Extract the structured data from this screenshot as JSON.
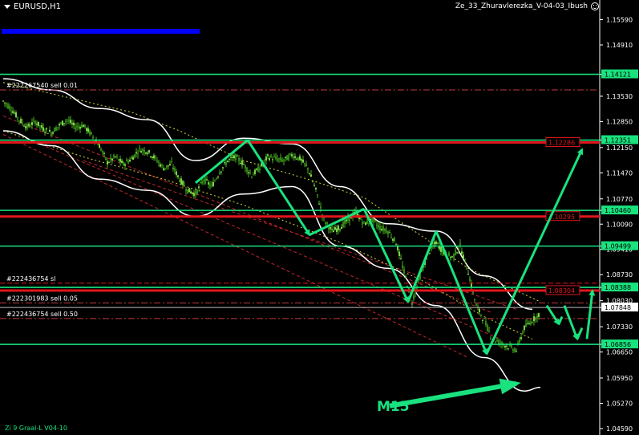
{
  "header": {
    "symbol_timeframe": "EURUSD,H1",
    "indicator_name": "Ze_33_Zhuravlerezka_V-04-03_Ibush"
  },
  "footer": {
    "text": "Zi 9 Graal-L V04-10"
  },
  "annotation": {
    "label": "M15"
  },
  "colors": {
    "background": "#000000",
    "green_level": "#19e27e",
    "red_level": "#e0161b",
    "arrow": "#19e27e",
    "band_white": "#ffffff",
    "blue_bar": "#0000ff",
    "candle": "#4caf20"
  },
  "chart_data": {
    "type": "candlestick",
    "symbol": "EURUSD",
    "timeframe": "H1",
    "y_axis": {
      "ticks": [
        "1.15590",
        "1.14910",
        "1.14121",
        "1.13530",
        "1.12850",
        "1.12351",
        "1.12150",
        "1.11470",
        "1.10770",
        "1.10460",
        "1.10090",
        "1.09499",
        "1.09410",
        "1.08730",
        "1.08388",
        "1.08030",
        "1.07848",
        "1.07330",
        "1.06856",
        "1.06650",
        "1.05950",
        "1.05270",
        "1.04590"
      ],
      "range": [
        1.0459,
        1.1586
      ]
    },
    "green_levels": [
      {
        "price": 1.14121,
        "label": "1.14121"
      },
      {
        "price": 1.12351,
        "label": "1.12351"
      },
      {
        "price": 1.1046,
        "label": "1.10460"
      },
      {
        "price": 1.09499,
        "label": "1.09499"
      },
      {
        "price": 1.08388,
        "label": "1.08388"
      },
      {
        "price": 1.06856,
        "label": "1.06856"
      }
    ],
    "red_levels": [
      {
        "price": 1.12286,
        "label": "1.12286"
      },
      {
        "price": 1.10295,
        "label": "1.10295"
      },
      {
        "price": 1.08304,
        "label": "1.08304"
      }
    ],
    "current_price": {
      "price": 1.07848,
      "label": "1.07848"
    },
    "orders": [
      {
        "text": "#222267540 sell 0.01",
        "price": 1.137
      },
      {
        "text": "#222436754 sl",
        "price": 1.085
      },
      {
        "text": "#222301983 sell 0.05",
        "price": 1.0797
      },
      {
        "text": "#222436754 sell 0.50",
        "price": 1.0755
      }
    ],
    "price_path": [
      [
        0,
        1.134
      ],
      [
        10,
        1.132
      ],
      [
        20,
        1.129
      ],
      [
        30,
        1.127
      ],
      [
        40,
        1.1285
      ],
      [
        50,
        1.1265
      ],
      [
        60,
        1.1255
      ],
      [
        70,
        1.1275
      ],
      [
        80,
        1.129
      ],
      [
        90,
        1.127
      ],
      [
        100,
        1.1275
      ],
      [
        110,
        1.125
      ],
      [
        120,
        1.122
      ],
      [
        130,
        1.1175
      ],
      [
        140,
        1.119
      ],
      [
        150,
        1.117
      ],
      [
        160,
        1.1185
      ],
      [
        170,
        1.121
      ],
      [
        180,
        1.1205
      ],
      [
        190,
        1.1185
      ],
      [
        200,
        1.116
      ],
      [
        210,
        1.117
      ],
      [
        220,
        1.113
      ],
      [
        230,
        1.11
      ],
      [
        240,
        1.109
      ],
      [
        250,
        1.113
      ],
      [
        260,
        1.111
      ],
      [
        270,
        1.115
      ],
      [
        280,
        1.118
      ],
      [
        290,
        1.119
      ],
      [
        300,
        1.117
      ],
      [
        310,
        1.114
      ],
      [
        320,
        1.116
      ],
      [
        330,
        1.119
      ],
      [
        340,
        1.1185
      ],
      [
        350,
        1.118
      ],
      [
        360,
        1.1195
      ],
      [
        370,
        1.1185
      ],
      [
        380,
        1.116
      ],
      [
        390,
        1.11
      ],
      [
        400,
        1.102
      ],
      [
        410,
        1.099
      ],
      [
        420,
        1.1
      ],
      [
        430,
        1.102
      ],
      [
        440,
        1.104
      ],
      [
        450,
        1.101
      ],
      [
        460,
        1.102
      ],
      [
        470,
        1.1
      ],
      [
        480,
        1.099
      ],
      [
        490,
        1.096
      ],
      [
        500,
        1.088
      ],
      [
        510,
        1.08
      ],
      [
        520,
        1.087
      ],
      [
        530,
        1.093
      ],
      [
        540,
        1.096
      ],
      [
        550,
        1.093
      ],
      [
        560,
        1.092
      ],
      [
        570,
        1.095
      ],
      [
        580,
        1.088
      ],
      [
        590,
        1.079
      ],
      [
        600,
        1.075
      ],
      [
        610,
        1.07
      ],
      [
        620,
        1.069
      ],
      [
        630,
        1.068
      ],
      [
        640,
        1.067
      ],
      [
        650,
        1.073
      ],
      [
        660,
        1.075
      ],
      [
        670,
        1.077
      ]
    ],
    "bands": {
      "upper_white": [
        [
          0,
          1.14
        ],
        [
          60,
          1.137
        ],
        [
          120,
          1.132
        ],
        [
          180,
          1.129
        ],
        [
          240,
          1.118
        ],
        [
          300,
          1.124
        ],
        [
          360,
          1.1225
        ],
        [
          420,
          1.111
        ],
        [
          480,
          1.101
        ],
        [
          540,
          1.099
        ],
        [
          600,
          1.087
        ],
        [
          660,
          1.078
        ]
      ],
      "lower_white": [
        [
          0,
          1.126
        ],
        [
          60,
          1.122
        ],
        [
          120,
          1.113
        ],
        [
          180,
          1.11
        ],
        [
          240,
          1.103
        ],
        [
          300,
          1.109
        ],
        [
          360,
          1.111
        ],
        [
          420,
          1.095
        ],
        [
          480,
          1.089
        ],
        [
          540,
          1.079
        ],
        [
          600,
          1.065
        ],
        [
          650,
          1.056
        ],
        [
          670,
          1.057
        ]
      ]
    },
    "arrows": [
      {
        "from": [
          240,
          1.112
        ],
        "to": [
          305,
          1.1235
        ]
      },
      {
        "from": [
          305,
          1.1235
        ],
        "to": [
          382,
          1.098
        ]
      },
      {
        "from": [
          382,
          1.098
        ],
        "to": [
          450,
          1.105
        ]
      },
      {
        "from": [
          450,
          1.105
        ],
        "to": [
          505,
          1.08
        ]
      },
      {
        "from": [
          505,
          1.08
        ],
        "to": [
          540,
          1.099
        ]
      },
      {
        "from": [
          540,
          1.099
        ],
        "to": [
          603,
          1.066
        ]
      },
      {
        "from": [
          603,
          1.066
        ],
        "to": [
          722,
          1.121
        ]
      },
      {
        "from": [
          678,
          1.079
        ],
        "to": [
          693,
          1.074
        ]
      },
      {
        "from": [
          693,
          1.074
        ],
        "to": [
          697,
          1.076
        ]
      },
      {
        "from": [
          700,
          1.079
        ],
        "to": [
          716,
          1.07
        ]
      },
      {
        "from": [
          716,
          1.07
        ],
        "to": [
          722,
          1.073
        ]
      },
      {
        "from": [
          728,
          1.07
        ],
        "to": [
          735,
          1.083
        ]
      },
      {
        "from": [
          482,
          1.052
        ],
        "to": [
          640,
          1.058
        ]
      }
    ]
  }
}
